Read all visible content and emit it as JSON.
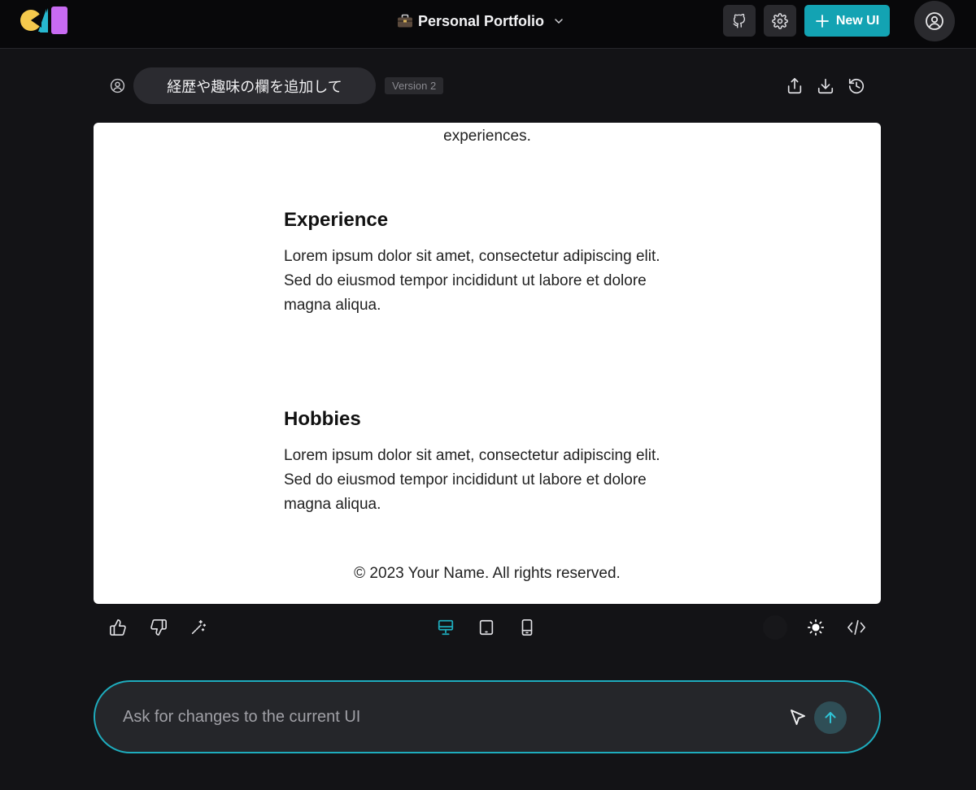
{
  "app": {
    "logo_icon": "app-logo",
    "colors": {
      "brand_yellow": "#f5c94d",
      "brand_cyan": "#27b7cf",
      "brand_purple": "#c86bf2",
      "accent": "#13a3b3",
      "accent_ring": "#1eacbd"
    }
  },
  "header": {
    "project_emoji": "briefcase-icon",
    "project_title": "Personal Portfolio",
    "github_icon": "github-icon",
    "settings_icon": "gear-icon",
    "new_ui_label": "New UI",
    "account_icon": "user-circle-icon"
  },
  "prompt": {
    "text": "経歴や趣味の欄を追加して",
    "version": "Version 2",
    "actions": [
      "share-icon",
      "download-icon",
      "history-icon"
    ]
  },
  "preview": {
    "intro_tail": "experiences.",
    "sections": [
      {
        "heading": "Experience",
        "body": "Lorem ipsum dolor sit amet, consectetur adipiscing elit. Sed do eiusmod tempor incididunt ut labore et dolore magna aliqua."
      },
      {
        "heading": "Hobbies",
        "body": "Lorem ipsum dolor sit amet, consectetur adipiscing elit. Sed do eiusmod tempor incididunt ut labore et dolore magna aliqua."
      }
    ],
    "footer": "© 2023 Your Name. All rights reserved."
  },
  "toolbar": {
    "left": [
      "thumbs-up-icon",
      "thumbs-down-icon",
      "magic-wand-icon"
    ],
    "center": [
      "desktop-icon",
      "tablet-icon",
      "mobile-icon"
    ],
    "active_view": "desktop-icon",
    "right": [
      "sun-icon",
      "code-icon"
    ]
  },
  "chat": {
    "placeholder": "Ask for changes to the current UI",
    "value": ""
  }
}
